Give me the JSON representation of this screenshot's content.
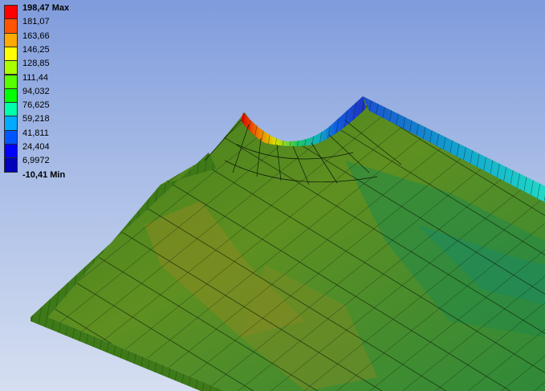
{
  "legend": {
    "max_value": "198,47",
    "max_suffix": "Max",
    "min_value": "-10,41",
    "min_suffix": "Min",
    "levels": [
      "181,07",
      "163,66",
      "146,25",
      "128,85",
      "111,44",
      "94,032",
      "76,625",
      "59,218",
      "41,811",
      "24,404",
      "6,9972"
    ],
    "colors": [
      "#ff0000",
      "#ff5500",
      "#ffaa00",
      "#ffff00",
      "#aaff00",
      "#55ff00",
      "#00ff00",
      "#00ffaa",
      "#00aaff",
      "#0055ff",
      "#0000ff",
      "#0000bb"
    ]
  },
  "view": {
    "background_top": "#7f9bdc",
    "background_bottom": "#d6dff1"
  }
}
